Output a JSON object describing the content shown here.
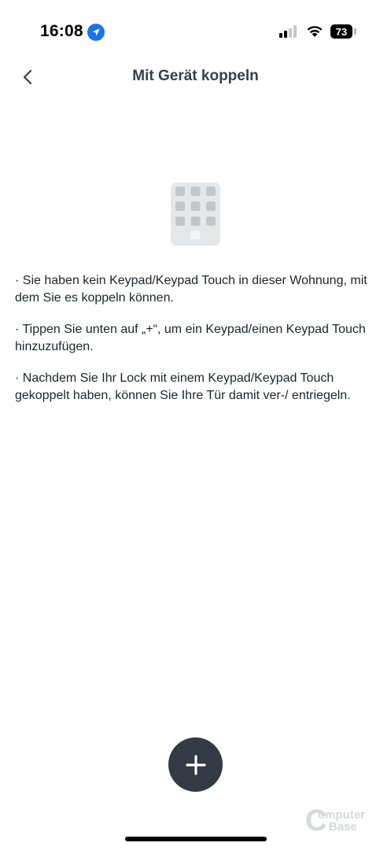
{
  "status_bar": {
    "time": "16:08",
    "battery_level": "73",
    "signal_bars_active": 2,
    "icons": [
      "location-arrow-icon",
      "cellular-signal-icon",
      "wifi-icon",
      "battery-icon"
    ]
  },
  "header": {
    "title": "Mit Gerät koppeln",
    "back_icon": "chevron-left-icon"
  },
  "illustration": {
    "icon": "keypad-icon",
    "rows": 3,
    "cols": 3
  },
  "info": {
    "paragraphs": [
      "· Sie haben kein Keypad/Keypad Touch in dieser Wohnung, mit dem Sie es koppeln können.",
      "· Tippen Sie unten auf „+“, um ein Keypad/einen Keypad Touch hinzuzufügen.",
      "· Nachdem Sie Ihr Lock mit einem Keypad/Keypad Touch gekoppelt haben, können Sie Ihre Tür damit ver-/ entriegeln."
    ]
  },
  "actions": {
    "add_icon": "plus-icon"
  },
  "watermark": {
    "line1": "omputer",
    "line2": "Base",
    "letter": "C"
  },
  "colors": {
    "fab_background": "#343a45",
    "title_text": "#3a3e45",
    "body_text": "#1f2329",
    "location_badge": "#1a73e8",
    "illustration_bg": "#e6e7e9",
    "illustration_keys": "#c4c6ca"
  }
}
